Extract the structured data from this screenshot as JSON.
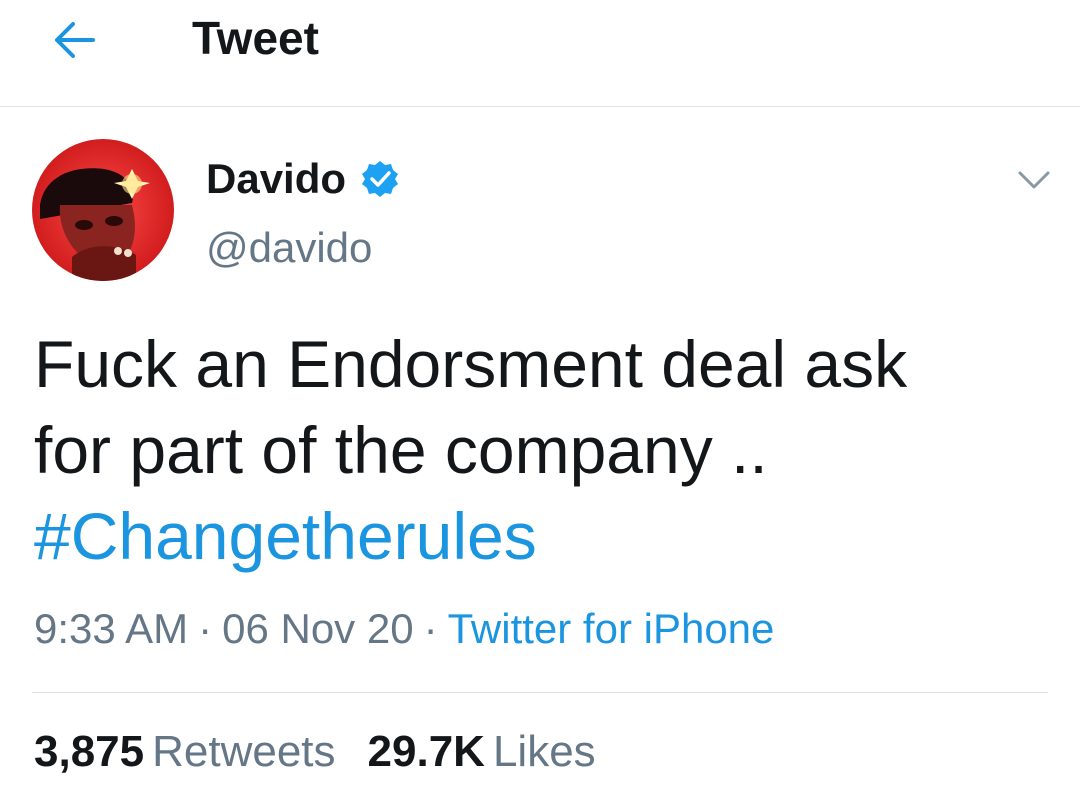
{
  "header": {
    "title": "Tweet",
    "back_icon": "arrow-left-icon"
  },
  "author": {
    "display_name": "Davido",
    "handle": "@davido",
    "verified": true
  },
  "tweet": {
    "text_line_1": "Fuck an Endorsment deal ask",
    "text_line_2": "for part of the company ..",
    "hashtag": "#Changetherules",
    "time": "9:33 AM",
    "date": "06 Nov 20",
    "separator": "·",
    "source": "Twitter for iPhone"
  },
  "stats": {
    "retweets_count": "3,875",
    "retweets_label": "Retweets",
    "likes_count": "29.7K",
    "likes_label": "Likes"
  },
  "colors": {
    "link_blue": "#1b95e0",
    "text_primary": "#14171a",
    "text_secondary": "#657786",
    "divider": "#dfe3e6"
  }
}
